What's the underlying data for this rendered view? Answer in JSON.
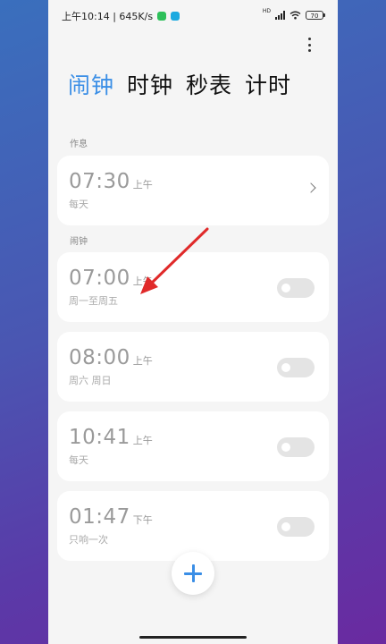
{
  "status_bar": {
    "time_speed": "上午10:14 | 645K/s",
    "network": "HD",
    "battery": "70"
  },
  "tabs": [
    {
      "label": "闹钟",
      "active": true
    },
    {
      "label": "时钟",
      "active": false
    },
    {
      "label": "秒表",
      "active": false
    },
    {
      "label": "计时",
      "active": false
    }
  ],
  "sections": {
    "rest_label": "作息",
    "alarm_label": "闹钟"
  },
  "rest_card": {
    "time": "07:30",
    "ampm": "上午",
    "repeat": "每天"
  },
  "alarms": [
    {
      "time": "07:00",
      "ampm": "上午",
      "repeat": "周一至周五",
      "enabled": false
    },
    {
      "time": "08:00",
      "ampm": "上午",
      "repeat": "周六 周日",
      "enabled": false
    },
    {
      "time": "10:41",
      "ampm": "上午",
      "repeat": "每天",
      "enabled": false
    },
    {
      "time": "01:47",
      "ampm": "下午",
      "repeat": "只响一次",
      "enabled": false
    }
  ],
  "colors": {
    "accent": "#3a8ee6",
    "annotation": "#e02a2a",
    "wechat_badge": "#2ec05a",
    "app_badge": "#1aa9e0"
  },
  "icons": {
    "more": "more-vertical-icon",
    "chevron": "chevron-right-icon",
    "add": "plus-icon"
  }
}
